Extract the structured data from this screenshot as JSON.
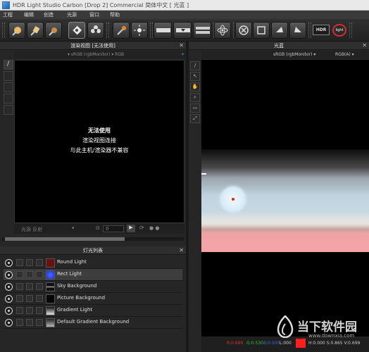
{
  "window": {
    "title": "HDR Light Studio Carbon [Drop 2] Commercial  简体中文 [ 光蓝 ]"
  },
  "menu": [
    "工程",
    "编辑",
    "创造",
    "光源",
    "窗口",
    "帮助"
  ],
  "toolbar": {
    "hdr_label": "HDR",
    "light_label": "light"
  },
  "render_panel": {
    "title": "渲染视图 [无法使用]",
    "options": "▾  sRGB (rgbMonitor)  ▾  RGB",
    "unavailable_title": "无法使用",
    "unavailable_line1": "渲染视图连接",
    "unavailable_line2": "与此主机/渲染器不兼容",
    "footer_left": "光源  反射",
    "footer_value": "0"
  },
  "canvas_panel": {
    "title": "光蓝",
    "colorspace": "sRGB (rgbMonitor)  ▾",
    "channel": "RGB(A)  ▾"
  },
  "lights_panel": {
    "title": "灯光列表",
    "lights": [
      {
        "name": "Round Light",
        "selected": false,
        "thumb_color": "#6a1010"
      },
      {
        "name": "Rect Light",
        "selected": true,
        "thumb_color": "#1a2fe0"
      },
      {
        "name": "Sky Background",
        "selected": false,
        "thumb_color": "#d8d8d8"
      },
      {
        "name": "Picture Background",
        "selected": false,
        "thumb_color": "#050505"
      },
      {
        "name": "Gradient Light",
        "selected": false,
        "thumb_color": "#e8e8e8"
      },
      {
        "name": "Default Gradient Background",
        "selected": false,
        "thumb_color": "#b8b8b8"
      }
    ]
  },
  "status": {
    "r": "R:0.699",
    "g": "G:0.530",
    "b": "B:0.500",
    "l": "L:000",
    "hsv": "H:0.000  S:0.865  V:0.699",
    "swatch_color": "#ff1f1f"
  },
  "watermark": {
    "text": "当下软件园",
    "url": "www.downxia.com"
  }
}
